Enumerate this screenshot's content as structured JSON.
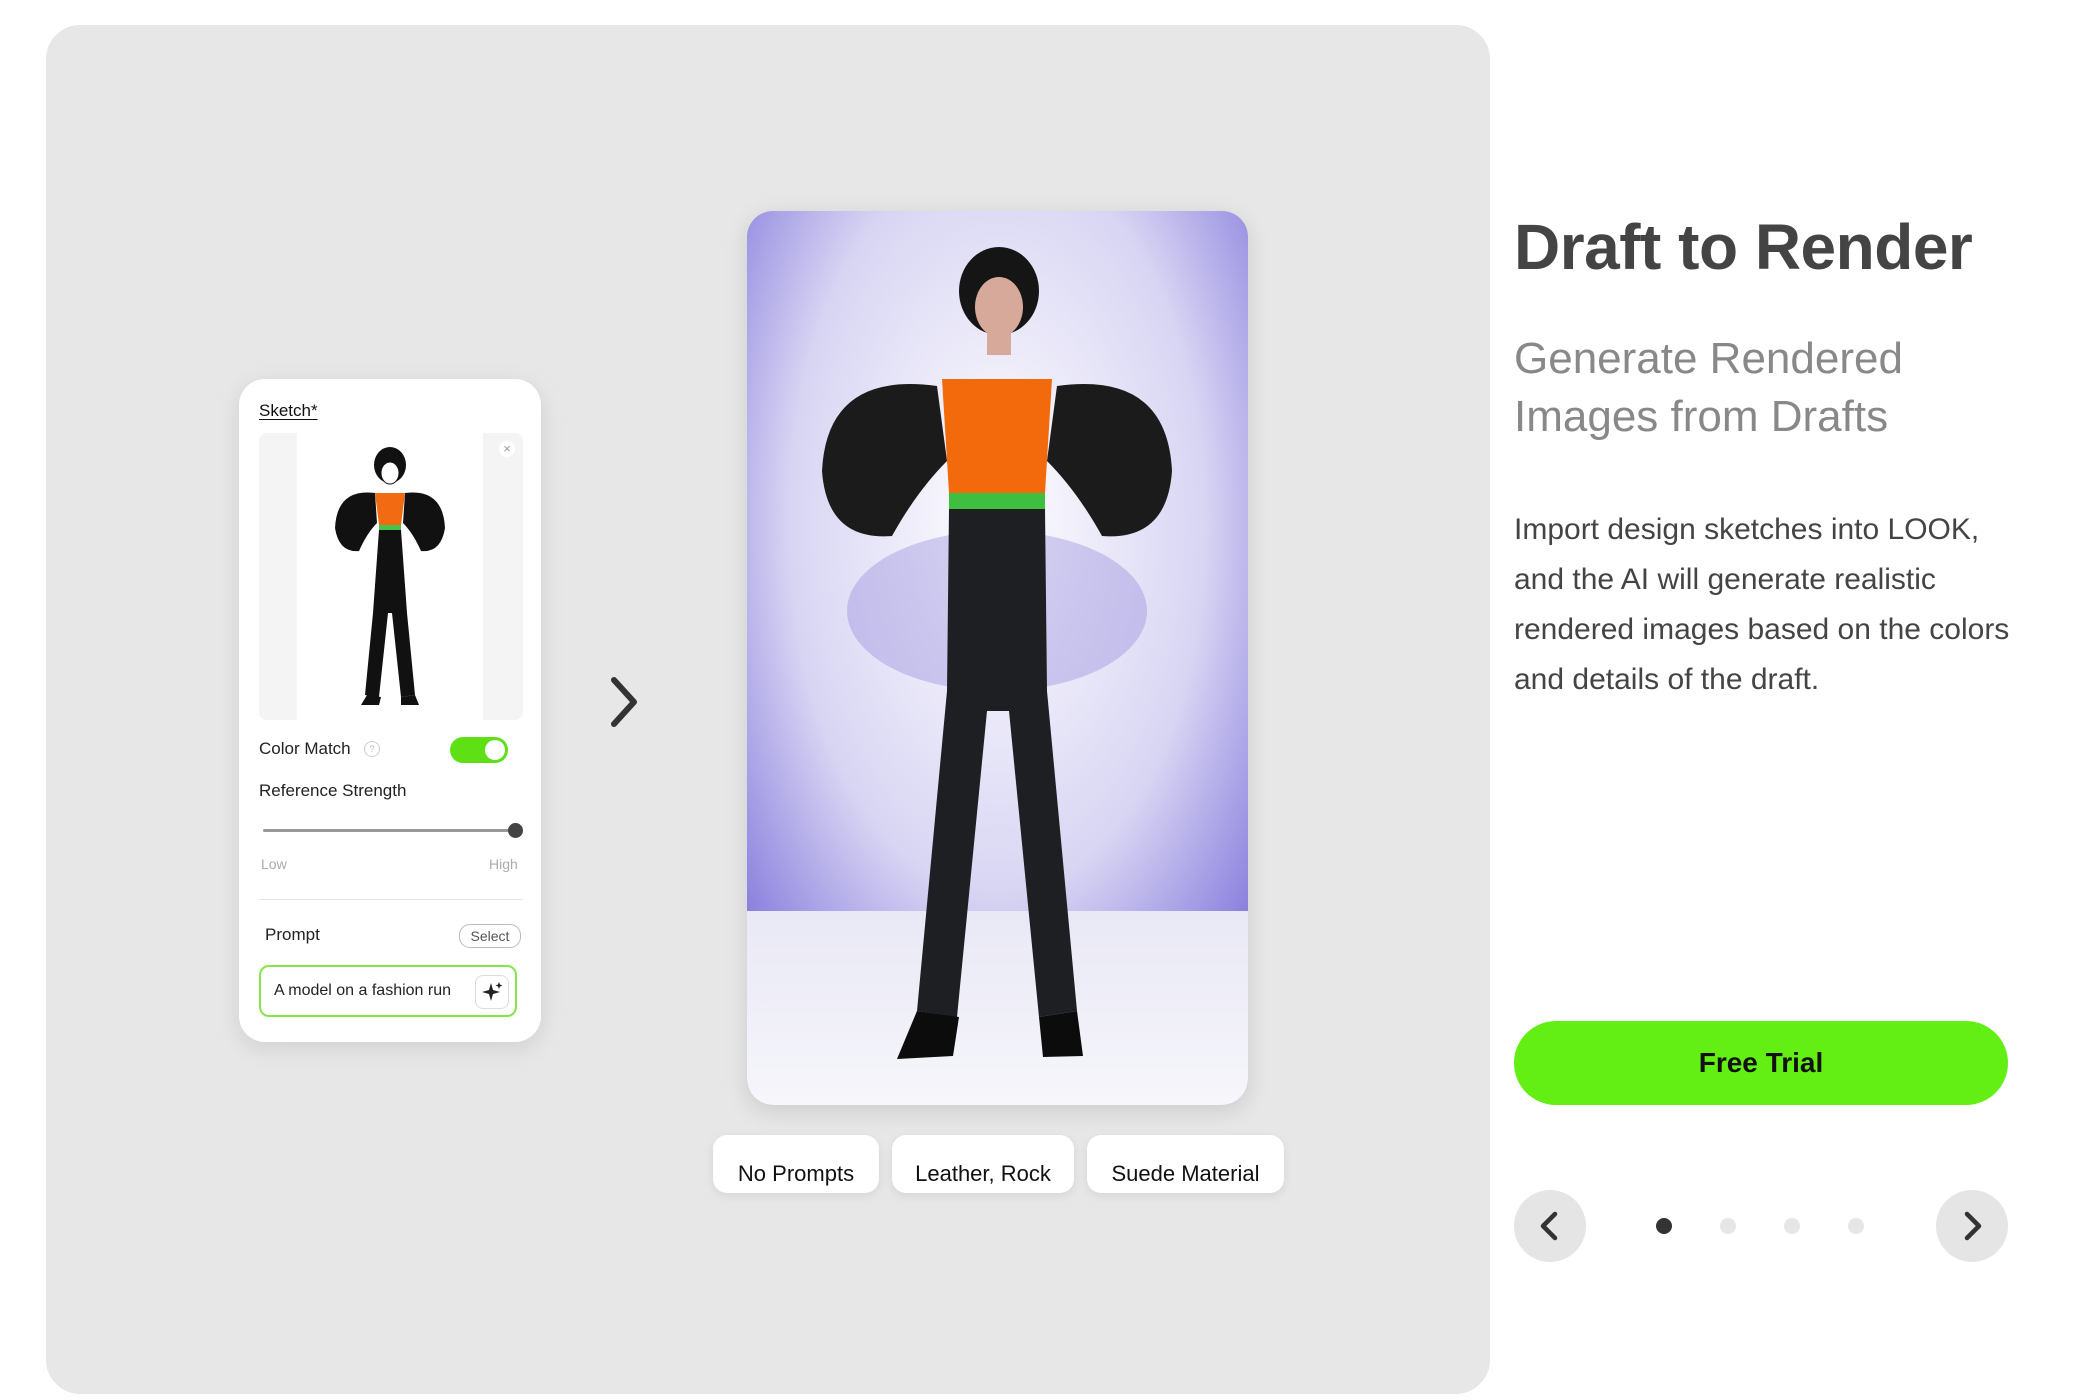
{
  "panel": {
    "title": "Sketch*",
    "color_match_label": "Color Match",
    "help": "?",
    "color_match_on": true,
    "reference_strength_label": "Reference Strength",
    "reference_strength_value": 1.0,
    "slider_low": "Low",
    "slider_high": "High",
    "prompt_label": "Prompt",
    "select_label": "Select",
    "prompt_value": "A model on a fashion run"
  },
  "chips": [
    {
      "label": "No Prompts"
    },
    {
      "label": "Leather, Rock"
    },
    {
      "label": "Suede Material"
    }
  ],
  "info": {
    "title": "Draft to Render",
    "subtitle": "Generate Rendered Images from Drafts",
    "description": "Import design sketches into LOOK, and the AI will generate realistic rendered images based on the colors and details of the draft.",
    "cta": "Free Trial"
  },
  "pagination": {
    "total": 4,
    "active": 1
  },
  "colors": {
    "accent": "#63ef13",
    "toggle": "#5fe015"
  },
  "icons": [
    "close-icon",
    "help-icon",
    "sparkle-icon",
    "chevron-right-icon",
    "chevron-left-icon"
  ]
}
